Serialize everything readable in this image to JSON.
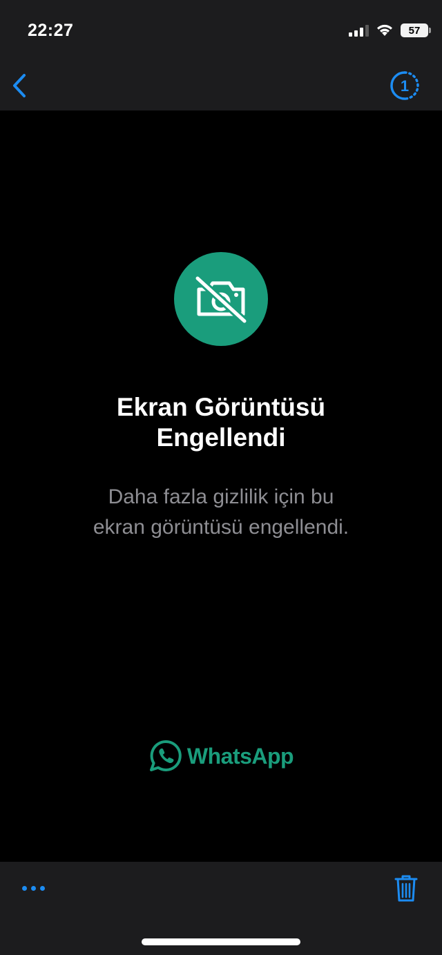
{
  "status_bar": {
    "time": "22:27",
    "battery_level": "57",
    "icons": [
      "signal-icon",
      "wifi-icon",
      "battery-icon"
    ]
  },
  "nav_bar": {
    "back_icon": "chevron-left-icon",
    "view_once_label": "1"
  },
  "content": {
    "icon": "camera-off-icon",
    "title_line1": "Ekran Görüntüsü",
    "title_line2": "Engellendi",
    "subtitle_line1": "Daha fazla gizlilik için bu",
    "subtitle_line2": "ekran görüntüsü engellendi.",
    "brand_name": "WhatsApp",
    "brand_icon": "whatsapp-logo-icon"
  },
  "bottom_bar": {
    "more_icon": "ellipsis-icon",
    "delete_icon": "trash-icon"
  },
  "colors": {
    "accent_blue": "#1c8cf2",
    "whatsapp_green": "#1a9d7c",
    "bar_background": "#1c1c1e",
    "subtitle_gray": "#8e8e93"
  }
}
